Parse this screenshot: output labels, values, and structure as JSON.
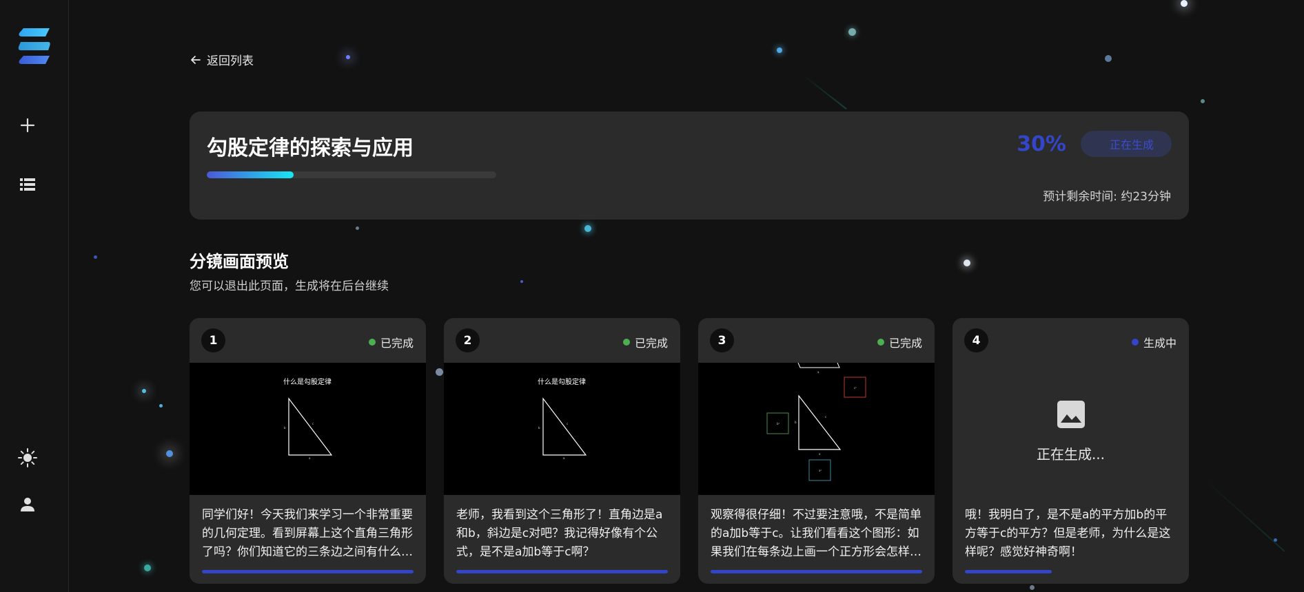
{
  "nav": {
    "back_label": "返回列表"
  },
  "sidebar": {
    "items": [
      {
        "icon": "plus-icon"
      },
      {
        "icon": "list-icon"
      },
      {
        "icon": "sun-icon"
      },
      {
        "icon": "user-icon"
      }
    ]
  },
  "progress": {
    "title": "勾股定律的探索与应用",
    "percent_label": "30%",
    "percent_value": 30,
    "status": "正在生成",
    "eta": "预计剩余时间: 约23分钟"
  },
  "storyboard": {
    "title": "分镜画面预览",
    "subtitle": "您可以退出此页面，生成将在后台继续",
    "scenes": [
      {
        "number": "1",
        "status": "已完成",
        "status_color": "#4caf50",
        "frame_title": "什么是勾股定律",
        "text": "同学们好！今天我们来学习一个非常重要的几何定理。看到屏幕上这个直角三角形了吗？你们知道它的三条边之间有什么关系吗？",
        "progress": 100
      },
      {
        "number": "2",
        "status": "已完成",
        "status_color": "#4caf50",
        "frame_title": "什么是勾股定律",
        "text": "老师，我看到这个三角形了！直角边是a和b，斜边是c对吧？我记得好像有个公式，是不是a加b等于c啊？",
        "progress": 100
      },
      {
        "number": "3",
        "status": "已完成",
        "status_color": "#4caf50",
        "frame_title": "",
        "text": "观察得很仔细！不过要注意哦，不是简单的a加b等于c。让我们看看这个图形：如果我们在每条边上画一个正方形会怎样呢？",
        "progress": 100
      },
      {
        "number": "4",
        "status": "生成中",
        "status_color": "#3346c9",
        "generating_label": "正在生成...",
        "text": "哦！我明白了，是不是a的平方加b的平方等于c的平方？但是老师，为什么是这样呢？感觉好神奇啊！",
        "progress": 41
      }
    ]
  },
  "colors": {
    "background": "#121212",
    "card": "#2b2b2b",
    "accent": "#3346c9",
    "progress_gradient_start": "#4b59d8",
    "progress_gradient_end": "#18e6f2",
    "done": "#4caf50"
  }
}
